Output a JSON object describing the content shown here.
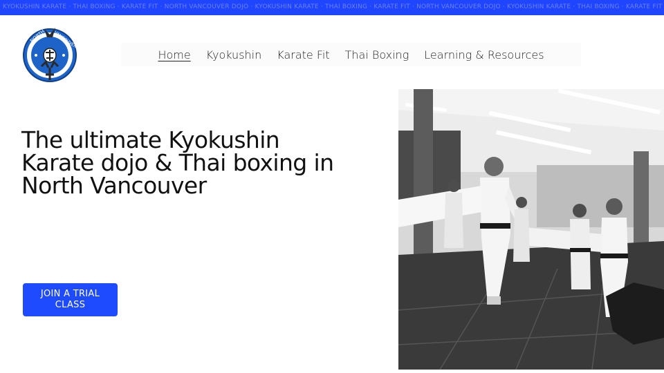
{
  "ticker": {
    "text": "KYOKUSHIN KARATE · THAI BOXING · KARATE FIT · NORTH VANCOUVER DOJO · KYOKUSHIN KARATE · THAI BOXING · KARATE FIT · NORTH VANCOUVER DOJO · KYOKUSHIN KARATE · THAI BOXING · KARATE FIT",
    "bg_color": "#1f45ff"
  },
  "logo": {
    "text_top": "NORTH",
    "text_right": "VANCOUVER",
    "icon": "dojo-crest-icon",
    "primary_color": "#1e64c8"
  },
  "nav": {
    "items": [
      {
        "label": "Home",
        "active": true
      },
      {
        "label": "Kyokushin"
      },
      {
        "label": "Karate Fit"
      },
      {
        "label": "Thai Boxing"
      },
      {
        "label": "Learning & Resources"
      }
    ]
  },
  "hero": {
    "title_line1": "The ultimate Kyokushin",
    "title_line2": "Karate dojo & Thai boxing in",
    "title_line3": "North Vancouver",
    "cta_label": "JOIN A TRIAL CLASS",
    "accent_color": "#1f4bff"
  },
  "photo": {
    "icon": "karate-class-photo"
  }
}
